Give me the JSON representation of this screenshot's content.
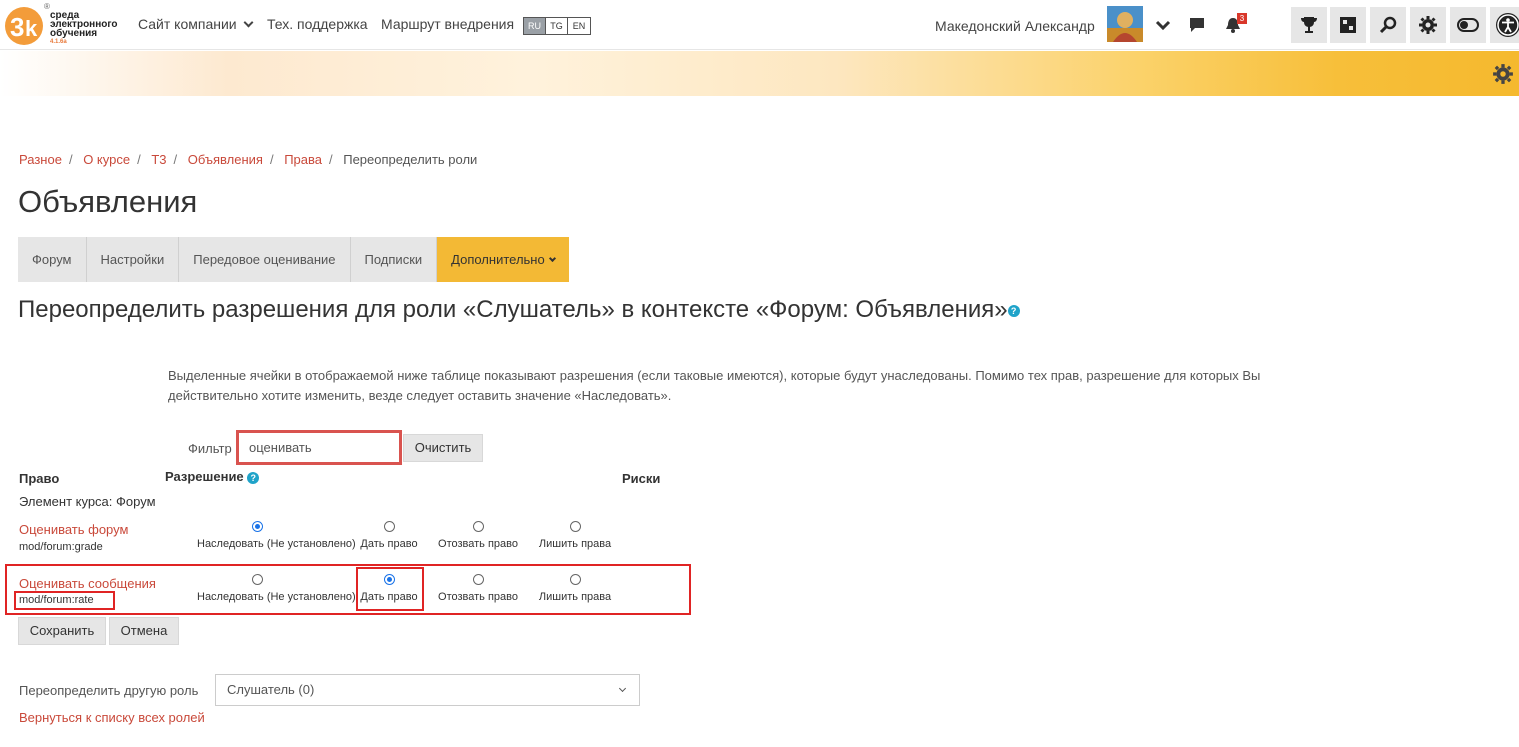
{
  "navbar": {
    "logo_text_1": "среда",
    "logo_text_2": "электронного",
    "logo_text_3": "обучения",
    "logo_version": "4.1.6a",
    "links": [
      "Сайт компании",
      "Тех. поддержка",
      "Маршрут внедрения"
    ],
    "languages": [
      "RU",
      "TG",
      "EN"
    ],
    "active_language": "RU",
    "user_name": "Македонский Александр",
    "notification_count": "3",
    "icons": [
      "trophy-icon",
      "puzzle-icon",
      "search-icon",
      "gear-icon",
      "toggle-icon",
      "accessibility-icon"
    ]
  },
  "breadcrumb": [
    "Разное",
    "О курсе",
    "Т3",
    "Объявления",
    "Права",
    "Переопределить роли"
  ],
  "page_title": "Объявления",
  "tabs": [
    "Форум",
    "Настройки",
    "Передовое оценивание",
    "Подписки",
    "Дополнительно"
  ],
  "active_tab": "Дополнительно",
  "heading": "Переопределить разрешения для роли «Слушатель» в контексте «Форум: Объявления»",
  "info": "Выделенные ячейки в отображаемой ниже таблице показывают разрешения (если таковые имеются), которые будут унаследованы. Помимо тех прав, разрешение для которых Вы действительно хотите изменить, везде следует оставить значение «Наследовать».",
  "filter": {
    "label": "Фильтр",
    "value": "оценивать",
    "clear_label": "Очистить"
  },
  "table": {
    "headers": [
      "Право",
      "Разрешение",
      "Риски"
    ],
    "group": "Элемент курса: Форум",
    "options": [
      "Наследовать (Не установлено)",
      "Дать право",
      "Отозвать право",
      "Лишить права"
    ],
    "rows": [
      {
        "name": "Оценивать форум",
        "code": "mod/forum:grade",
        "selected": 0
      },
      {
        "name": "Оценивать сообщения",
        "code": "mod/forum:rate",
        "selected": 1
      }
    ]
  },
  "buttons": {
    "save": "Сохранить",
    "cancel": "Отмена"
  },
  "other_role": {
    "label": "Переопределить другую роль",
    "selected": "Слушатель (0)"
  },
  "back_link": "Вернуться к списку всех ролей",
  "colors": {
    "accent": "#f3b935",
    "link": "#c9493a",
    "highlight": "#e02424",
    "help": "#1fa3c9"
  }
}
